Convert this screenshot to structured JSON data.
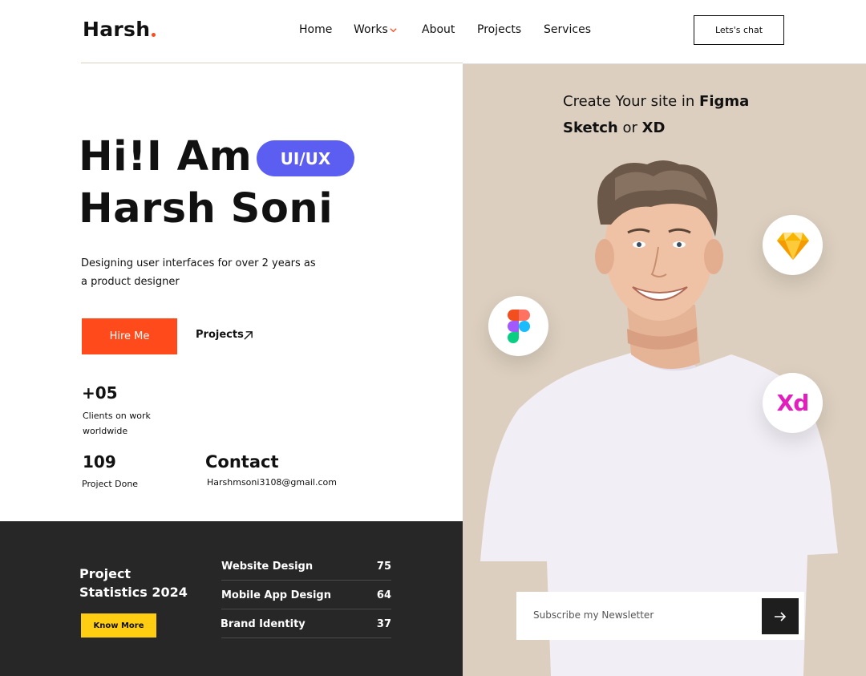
{
  "header": {
    "logo": "Harsh",
    "nav": [
      "Home",
      "Works",
      "About",
      "Projects",
      "Services"
    ],
    "cta": "Lets's chat"
  },
  "hero": {
    "line1": "Hi!I Am",
    "line2": "Harsh Soni",
    "pill": "UI/UX",
    "description": "Designing user interfaces for over 2 years as a product designer",
    "hire_btn": "Hire Me",
    "projects_link": "Projects"
  },
  "stats": {
    "clients_num": "+05",
    "clients_label": "Clients on work worldwide",
    "projects_num": "109",
    "projects_label": "Project Done",
    "contact_title": "Contact",
    "contact_email": "Harshmsoni3108@gmail.com"
  },
  "right": {
    "tagline_pre": "Create Your site in ",
    "tagline_figma": "Figma",
    "tagline_sketch": "Sketch",
    "tagline_or": " or ",
    "tagline_xd": "XD",
    "xd_label": "Xd",
    "newsletter_placeholder": "Subscribe my Newsletter"
  },
  "project_stats": {
    "title": "Project Statistics 2024",
    "button": "Know More",
    "rows": [
      {
        "name": "Website Design",
        "value": "75"
      },
      {
        "name": "Mobile App Design",
        "value": "64"
      },
      {
        "name": "Brand Identity",
        "value": "37"
      }
    ]
  },
  "colors": {
    "accent": "#ff4a1c",
    "pill": "#5b5ef0",
    "panel": "#dccfbf",
    "dark": "#272727",
    "yellow": "#ffcd12"
  }
}
